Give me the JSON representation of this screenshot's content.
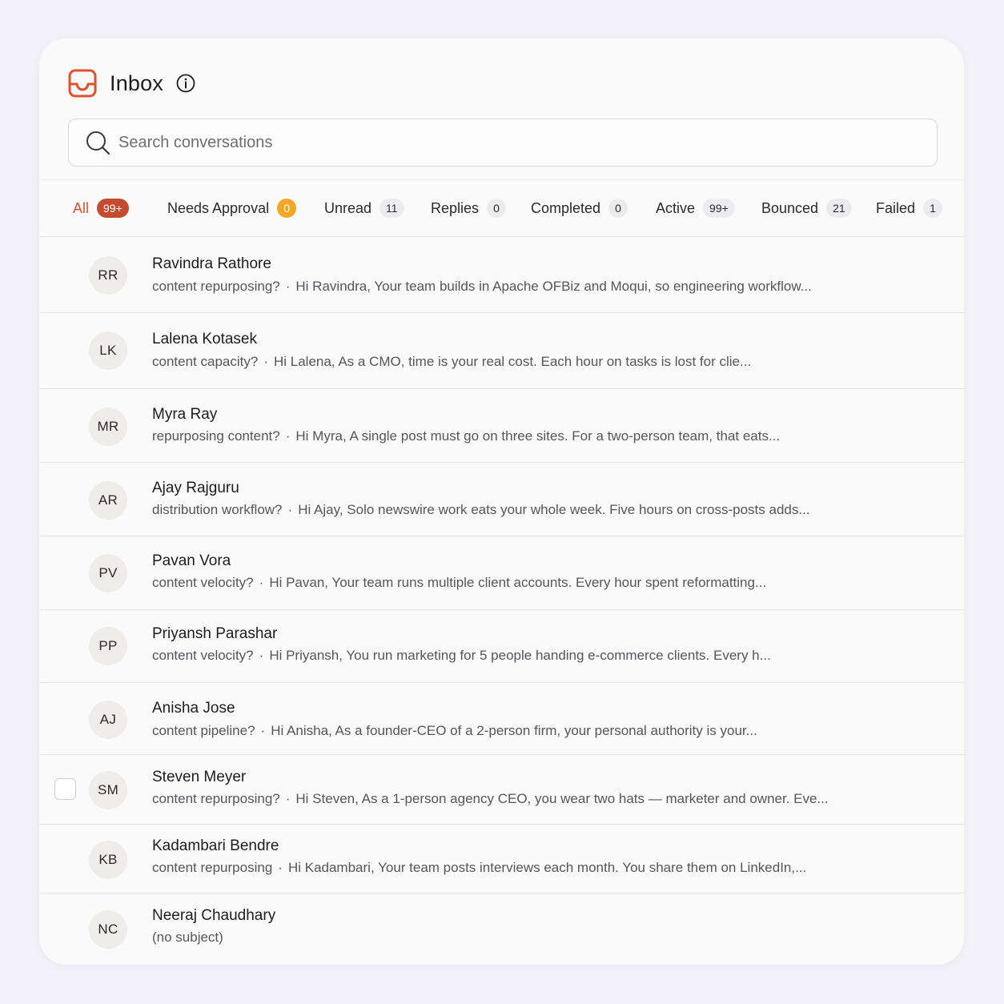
{
  "header": {
    "title": "Inbox",
    "logo_icon": "inbox-tray-icon",
    "info_icon": "info-icon",
    "accent_color": "#e0512d"
  },
  "search": {
    "placeholder": "Search conversations",
    "value": "",
    "icon": "search-icon"
  },
  "tabs": [
    {
      "label": "All",
      "count": "99+",
      "active": true
    },
    {
      "label": "Needs Approval",
      "count": "0"
    },
    {
      "label": "Unread",
      "count": "11"
    },
    {
      "label": "Replies",
      "count": "0"
    },
    {
      "label": "Completed",
      "count": "0"
    },
    {
      "label": "Active",
      "count": "99+"
    },
    {
      "label": "Bounced",
      "count": "21"
    },
    {
      "label": "Failed",
      "count": "1"
    }
  ],
  "conversations": [
    {
      "initials": "RR",
      "name": "Ravindra Rathore",
      "subject": "content repurposing?",
      "preview": "Hi Ravindra, Your team builds in Apache OFBiz and Moqui, so engineering workflow..."
    },
    {
      "initials": "LK",
      "name": "Lalena Kotasek",
      "subject": "content capacity?",
      "preview": "Hi Lalena, As a CMO, time is your real cost. Each hour on tasks is lost for clie..."
    },
    {
      "initials": "MR",
      "name": "Myra Ray",
      "subject": "repurposing content?",
      "preview": "Hi Myra, A single post must go on three sites. For a two-person team, that eats..."
    },
    {
      "initials": "AR",
      "name": "Ajay Rajguru",
      "subject": "distribution workflow?",
      "preview": "Hi Ajay, Solo newswire work eats your whole week. Five hours on cross-posts adds..."
    },
    {
      "initials": "PV",
      "name": "Pavan Vora",
      "subject": "content velocity?",
      "preview": "Hi Pavan, Your team runs multiple client accounts. Every hour spent reformatting..."
    },
    {
      "initials": "PP",
      "name": "Priyansh Parashar",
      "subject": "content velocity?",
      "preview": "Hi Priyansh, You run marketing for 5 people handing e-commerce clients. Every h..."
    },
    {
      "initials": "AJ",
      "name": "Anisha Jose",
      "subject": "content pipeline?",
      "preview": "Hi Anisha, As a founder-CEO of a 2-person firm, your personal authority is your..."
    },
    {
      "initials": "SM",
      "name": "Steven Meyer",
      "subject": "content repurposing?",
      "preview": "Hi Steven, As a 1-person agency CEO, you wear two hats — marketer and owner. Eve...",
      "checkbox_visible": true
    },
    {
      "initials": "KB",
      "name": "Kadambari Bendre",
      "subject": "content repurposing",
      "preview": "Hi Kadambari, Your team posts interviews each month. You share them on LinkedIn,..."
    },
    {
      "initials": "NC",
      "name": "Neeraj Chaudhary",
      "subject": "(no subject)",
      "preview": ""
    }
  ],
  "separator": "·"
}
